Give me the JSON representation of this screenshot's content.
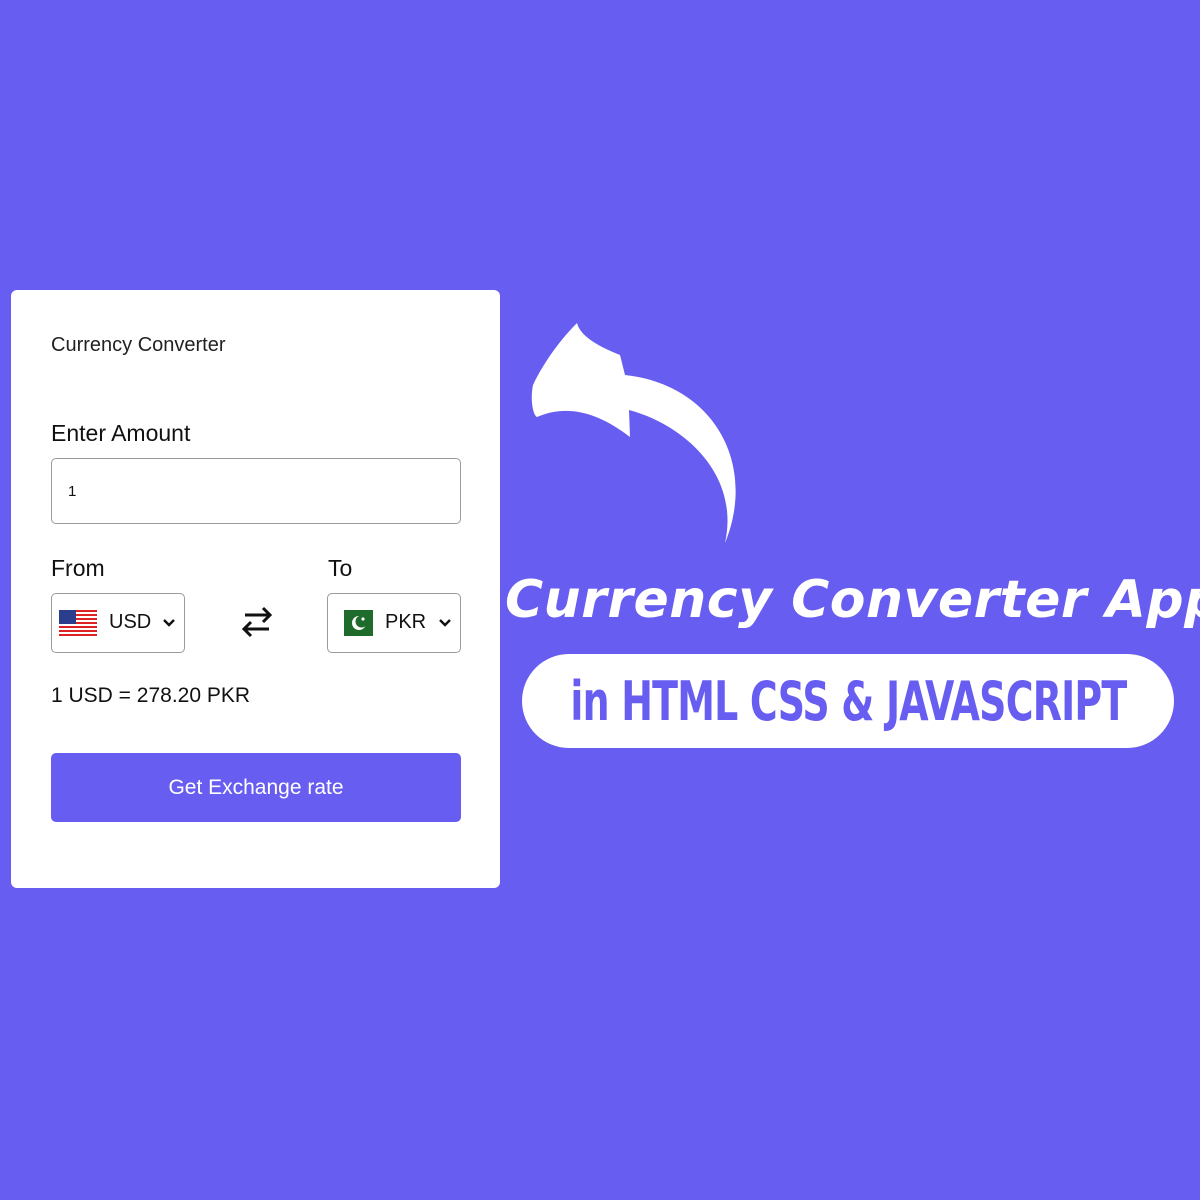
{
  "converter": {
    "title": "Currency Converter",
    "amount_label": "Enter Amount",
    "amount_value": "1",
    "from_label": "From",
    "to_label": "To",
    "from_currency": "USD",
    "to_currency": "PKR",
    "from_flag_icon": "us-flag-icon",
    "to_flag_icon": "pk-flag-icon",
    "swap_icon": "swap-arrows-icon",
    "rate_text": "1 USD = 278.20 PKR",
    "button_label": "Get Exchange rate"
  },
  "banner": {
    "headline": "Currency Converter App",
    "subheadline": "in HTML CSS & JAVASCRIPT",
    "arrow_icon": "curved-arrow-icon"
  },
  "colors": {
    "background": "#675df0",
    "card": "#ffffff",
    "button": "#675df0",
    "button_text": "#ffffff"
  }
}
